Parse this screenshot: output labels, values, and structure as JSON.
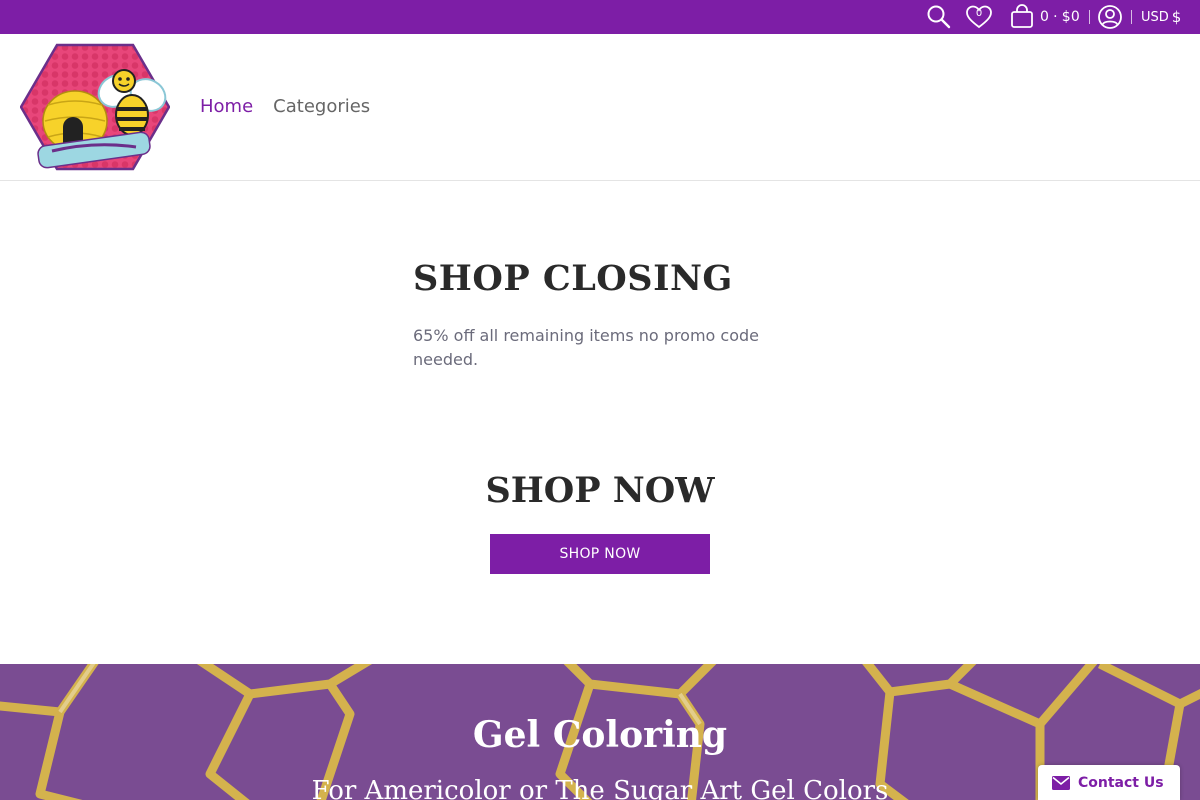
{
  "colors": {
    "brand": "#7d1ea6",
    "banner": "#7a4c92",
    "honeycomb": "#d9b84a"
  },
  "topbar": {
    "wishlist_count": "0",
    "cart_count": "0",
    "cart_separator": "·",
    "cart_total": "$0",
    "currency_code": "USD",
    "currency_symbol": "$",
    "icons": [
      "search-icon",
      "heart-icon",
      "cart-icon",
      "account-icon"
    ]
  },
  "header": {
    "logo_alt": "Bee's Baked Art",
    "nav": [
      {
        "label": "Home",
        "active": true
      },
      {
        "label": "Categories",
        "active": false
      }
    ]
  },
  "closing": {
    "title": "SHOP CLOSING",
    "text": "65% off all remaining items no promo code needed."
  },
  "shop_now": {
    "title": "SHOP NOW",
    "button_label": "SHOP NOW"
  },
  "banner": {
    "title": "Gel Coloring",
    "subtitle": "For Americolor or The Sugar Art Gel Colors"
  },
  "contact": {
    "label": "Contact Us",
    "icon": "envelope-icon"
  }
}
